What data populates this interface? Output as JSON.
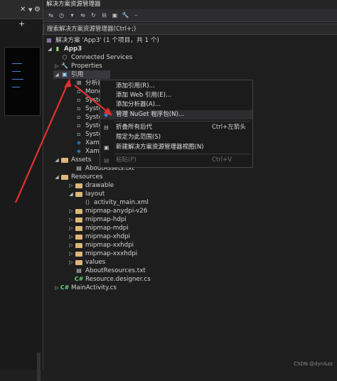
{
  "left": {
    "close_sym": "✕",
    "gear_sym": "⚙",
    "plus_sym": "+"
  },
  "panel": {
    "title": "解决方案资源管理器",
    "search_placeholder": "搜索解决方案资源管理器(Ctrl+;)"
  },
  "tree": {
    "solution": "解决方案 'App3' (1 个项目，共 1 个)",
    "project": "App3",
    "connected": "Connected Services",
    "properties": "Properties",
    "refs": "引用",
    "analyzer": "分析器",
    "mono": "Mono",
    "sys1": "Syster",
    "sys2": "Syster",
    "sys3": "Syster",
    "sys4": "Syster",
    "sys5": "Syster",
    "xam1": "Xama",
    "xam2": "Xama",
    "assets": "Assets",
    "aboutassets": "AboutAssets.txt",
    "resources": "Resources",
    "drawable": "drawable",
    "layout": "layout",
    "activity_main": "activity_main.xml",
    "mm_anydpi": "mipmap-anydpi-v26",
    "mm_hdpi": "mipmap-hdpi",
    "mm_mdpi": "mipmap-mdpi",
    "mm_xhdpi": "mipmap-xhdpi",
    "mm_xxhdpi": "mipmap-xxhdpi",
    "mm_xxxhdpi": "mipmap-xxxhdpi",
    "values": "values",
    "aboutres": "AboutResources.txt",
    "resdesigner": "Resource.designer.cs",
    "mainactivity": "MainActivity.cs"
  },
  "menu": {
    "add_ref": "添加引用(R)...",
    "add_web_ref": "添加 Web 引用(E)...",
    "add_analyzer": "添加分析器(A)...",
    "manage_nuget": "管理 NuGet 程序包(N)...",
    "collapse_all": "折叠所有后代",
    "collapse_key": "Ctrl+左箭头",
    "scope": "限定为此范围(S)",
    "new_view": "新建解决方案资源管理器视图(N)",
    "paste": "粘贴(P)",
    "paste_key": "Ctrl+V"
  },
  "watermark": "CSDN @dyn&zz",
  "colors": {
    "arrow": "#e0312f",
    "folder": "#dcb67a",
    "csharp": "#68d17c"
  }
}
